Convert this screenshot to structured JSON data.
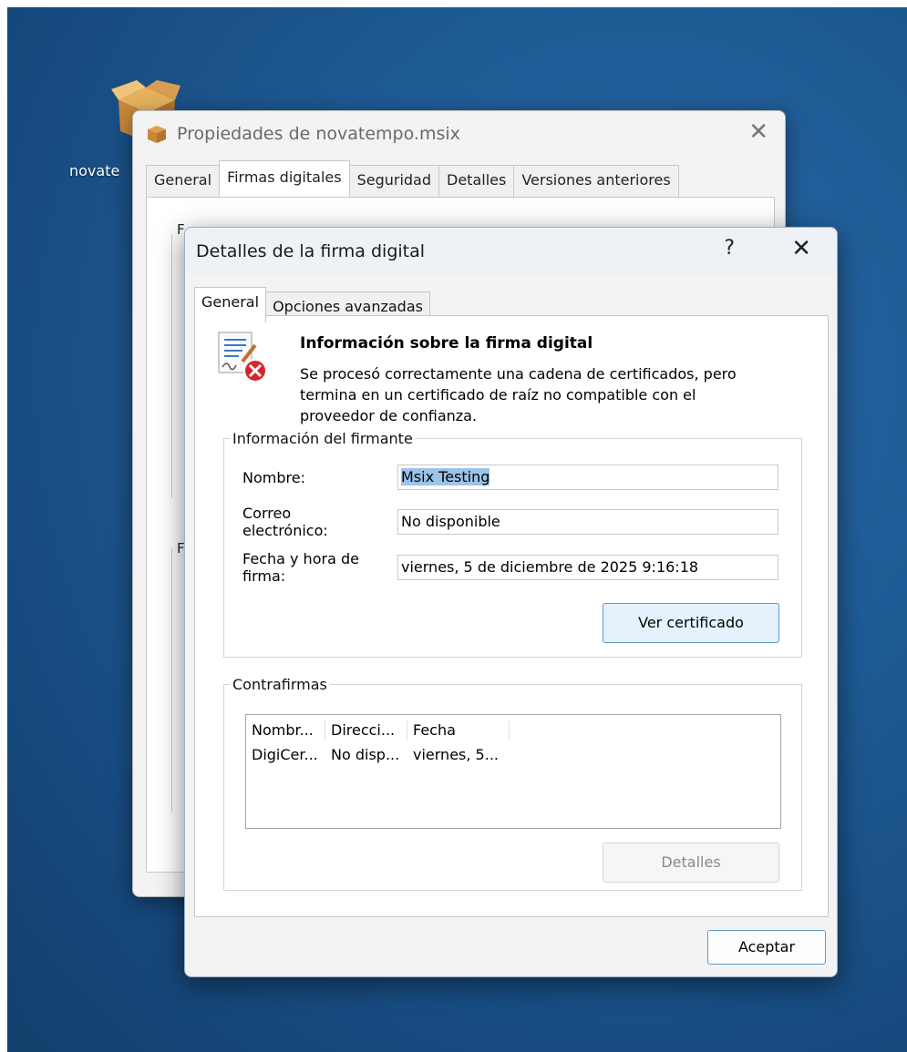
{
  "desktop": {
    "icon_label": "novate"
  },
  "back_window": {
    "title": "Propiedades de novatempo.msix",
    "close_glyph": "✕",
    "tabs": [
      "General",
      "Firmas digitales",
      "Seguridad",
      "Detalles",
      "Versiones anteriores"
    ],
    "active_tab": "Firmas digitales",
    "fragments": [
      "F",
      "F"
    ]
  },
  "dialog": {
    "title": "Detalles de la firma digital",
    "help_glyph": "?",
    "close_glyph": "✕",
    "tabs": [
      "General",
      "Opciones avanzadas"
    ],
    "active_tab": "General",
    "info": {
      "heading": "Información sobre la firma digital",
      "description": "Se procesó correctamente una cadena de certificados, pero termina en un certificado de raíz no compatible con el proveedor de confianza."
    },
    "signer": {
      "group_title": "Información del firmante",
      "name_label": "Nombre:",
      "name_value": "Msix Testing",
      "email_label_1": "Correo",
      "email_label_2": "electrónico:",
      "email_value": "No disponible",
      "date_label_1": "Fecha y hora de",
      "date_label_2": "firma:",
      "date_value": "viernes, 5 de diciembre de 2025 9:16:18",
      "view_cert_button": "Ver certificado"
    },
    "countersignatures": {
      "group_title": "Contrafirmas",
      "columns": [
        "Nombr...",
        "Direcci...",
        "Fecha"
      ],
      "rows": [
        [
          "DigiCer...",
          "No disp...",
          "viernes, 5..."
        ]
      ],
      "details_button": "Detalles"
    },
    "ok_button": "Aceptar"
  }
}
